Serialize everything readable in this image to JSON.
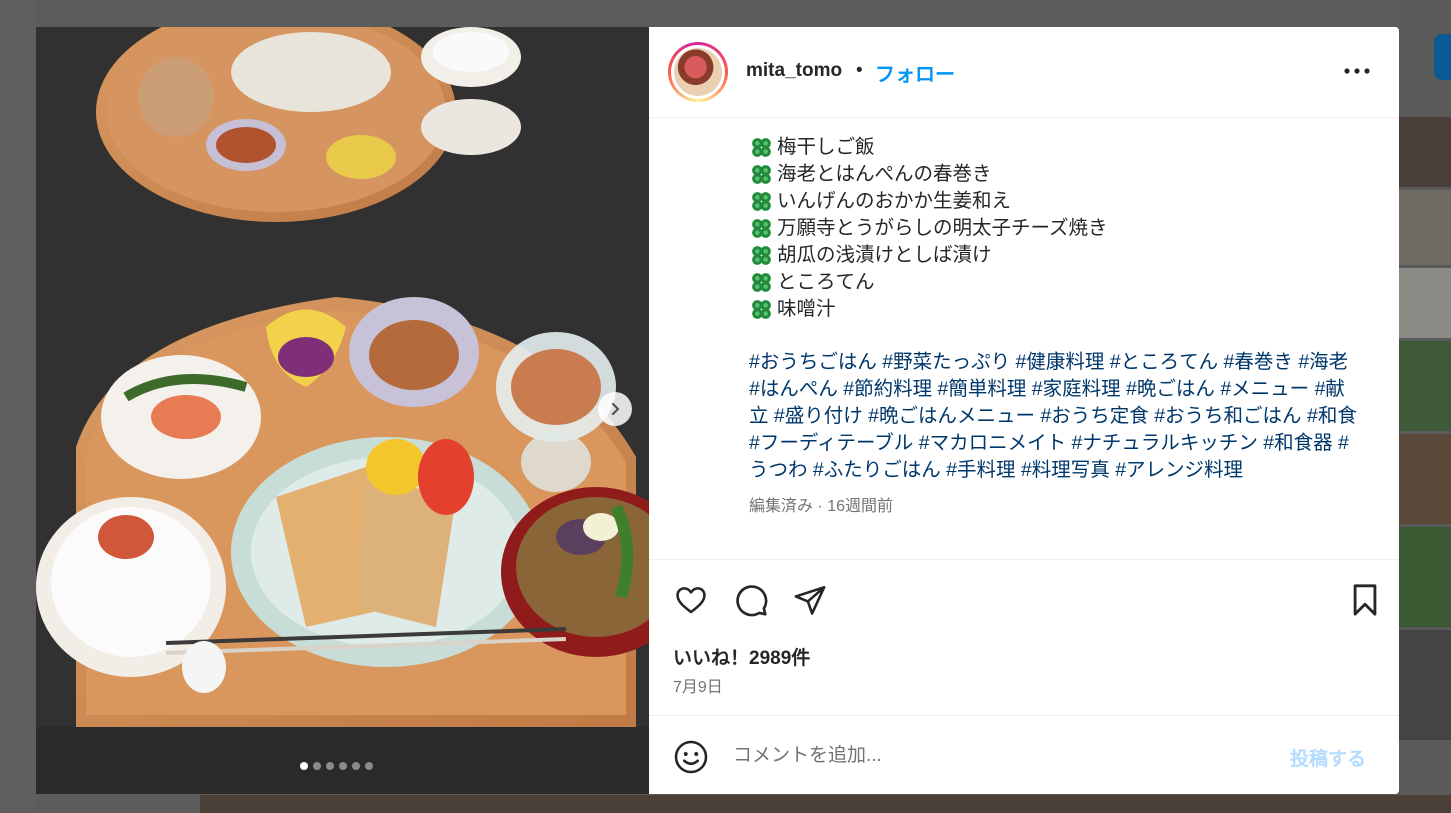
{
  "post": {
    "username": "mita_tomo",
    "separator": "•",
    "follow_label": "フォロー",
    "dishes": [
      "梅干しご飯",
      "海老とはんぺんの春巻き",
      "いんげんのおかか生姜和え",
      "万願寺とうがらしの明太子チーズ焼き",
      "胡瓜の浅漬けとしば漬け",
      "ところてん",
      "味噌汁"
    ],
    "hashtags_text": "#おうちごはん #野菜たっぷり #健康料理 #ところてん #春巻き #海老 #はんぺん #節約料理 #簡単料理 #家庭料理 #晩ごはん #メニュー #献立 #盛り付け #晩ごはんメニュー #おうち定食 #おうち和ごはん #和食 #フーディテーブル #マカロニメイト #ナチュラルキッチン #和食器 #うつわ #ふたりごはん #手料理 #料理写真 #アレンジ料理",
    "edited_meta": "編集済み · 16週間前",
    "likes": "いいね！2989件",
    "date": "7月9日"
  },
  "media": {
    "slide_count": 6,
    "active_slide": 1
  },
  "comment": {
    "placeholder": "コメントを追加...",
    "post_label": "投稿する"
  },
  "icons": [
    "more-icon",
    "heart-icon",
    "comment-icon",
    "share-icon",
    "bookmark-icon",
    "emoji-icon",
    "chevron-right-icon",
    "clover-icon"
  ],
  "colors": {
    "accent": "#0095f6",
    "hashtag": "#00376b",
    "muted": "#737373",
    "post_disabled": "#b3dbff"
  }
}
